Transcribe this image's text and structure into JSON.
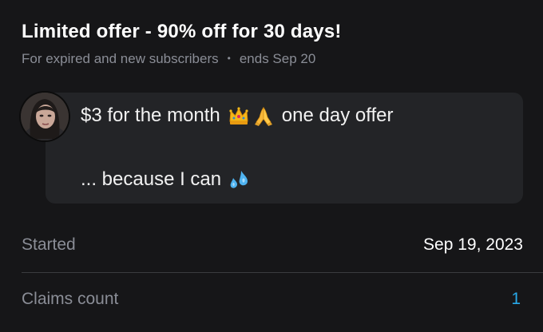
{
  "offer": {
    "title": "Limited offer - 90% off for 30 days!",
    "audience": "For expired and new subscribers",
    "separator": "•",
    "ends": "ends Sep 20"
  },
  "message": {
    "line1_text": "$3 for the month",
    "line1_emojis": [
      "crown-emoji",
      "folded-hands-emoji"
    ],
    "line1_suffix": "one day offer",
    "line2_text": "... because I can",
    "line2_emojis": [
      "sweat-droplets-emoji"
    ]
  },
  "details": {
    "started_label": "Started",
    "started_value": "Sep 19, 2023",
    "claims_label": "Claims count",
    "claims_value": "1"
  },
  "colors": {
    "background": "#161618",
    "bubble": "#232427",
    "muted_text": "#8a8d96",
    "accent_blue": "#28a8e8"
  }
}
